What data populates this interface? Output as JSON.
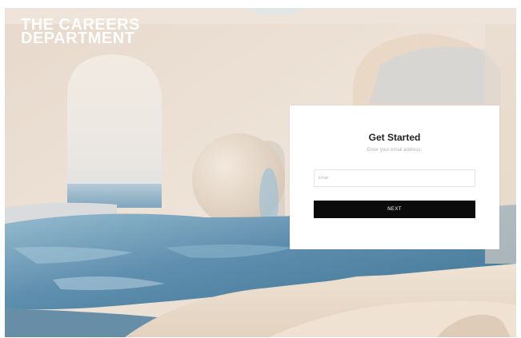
{
  "brand": {
    "line1": "THE CAREERS",
    "line2": "DEPARTMENT"
  },
  "form": {
    "title": "Get Started",
    "subtitle": "Enter your email address.",
    "email_placeholder": "Email",
    "email_value": "",
    "next_label": "NEXT"
  },
  "colors": {
    "card_background": "#ffffff",
    "button_background": "#0b0b0b",
    "button_text": "#ffffff",
    "title_text": "#222222",
    "subtitle_text": "#b5b5b5",
    "brand_text": "#ffffff",
    "wall": "#eadfd3",
    "water": "#6f9ab4"
  }
}
